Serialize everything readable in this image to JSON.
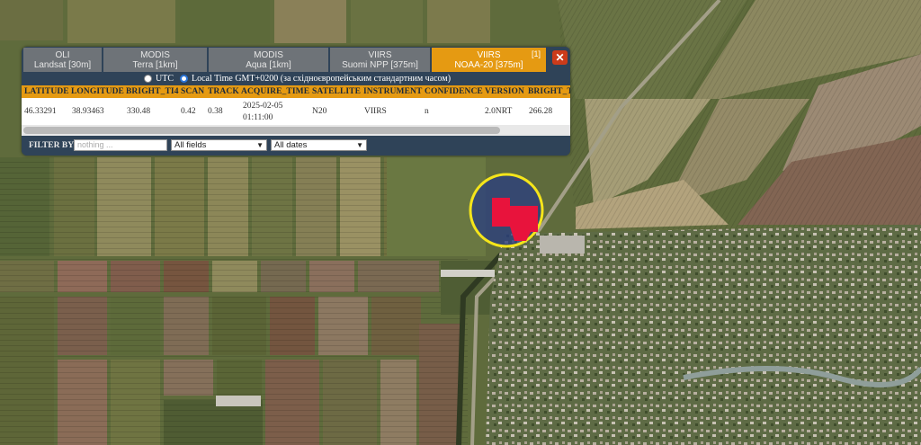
{
  "map": {
    "colors": {
      "fire_pixel": "#e8133c",
      "highlight_ring": "#f5e51a",
      "panel_bg": "#2f4358",
      "accent": "#e59a12"
    }
  },
  "tabs": [
    {
      "line1": "OLI",
      "line2": "Landsat [30m]",
      "active": false
    },
    {
      "line1": "MODIS",
      "line2": "Terra [1km]",
      "active": false
    },
    {
      "line1": "MODIS",
      "line2": "Aqua [1km]",
      "active": false
    },
    {
      "line1": "VIIRS",
      "line2": "Suomi NPP [375m]",
      "active": false
    },
    {
      "line1": "VIIRS",
      "line2": "NOAA-20 [375m]",
      "active": true,
      "count": "[1]"
    }
  ],
  "close_label": "✕",
  "time_options": {
    "utc": "UTC",
    "local": "Local Time GMT+0200 (за східноєвропейським стандартним часом)",
    "selected": "local"
  },
  "table": {
    "headers": [
      "LATITUDE",
      "LONGITUDE",
      "BRIGHT_TI4",
      "SCAN",
      "TRACK",
      "ACQUIRE_TIME",
      "SATELLITE",
      "INSTRUMENT",
      "CONFIDENCE",
      "VERSION",
      "BRIGHT_T"
    ],
    "rows": [
      {
        "latitude": "46.33291",
        "longitude": "38.93463",
        "bright_ti4": "330.48",
        "scan": "0.42",
        "track": "0.38",
        "acquire_date": "2025-02-05",
        "acquire_clock": "01:11:00",
        "satellite": "N20",
        "instrument": "VIIRS",
        "confidence": "n",
        "version": "2.0NRT",
        "bright_t": "266.28"
      }
    ]
  },
  "filter": {
    "label": "FILTER BY",
    "placeholder": "nothing ...",
    "field_select": "All fields",
    "date_select": "All dates"
  }
}
